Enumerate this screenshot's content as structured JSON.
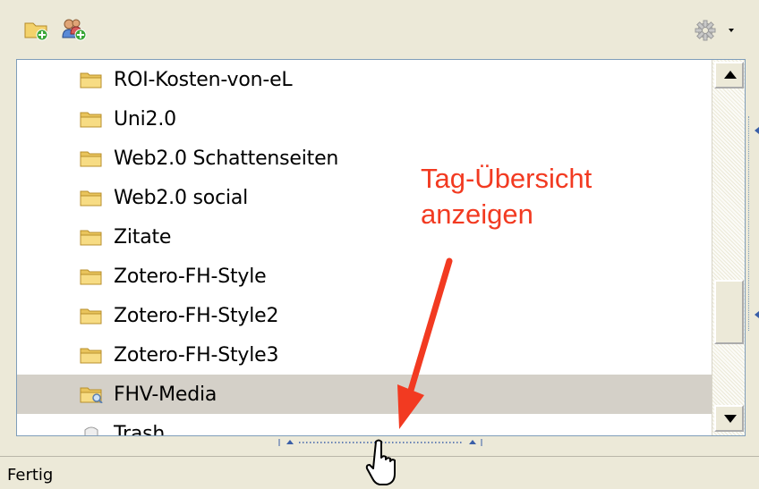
{
  "toolbar": {
    "new_collection_icon": "folder-add-icon",
    "new_group_icon": "users-add-icon",
    "actions_icon": "gear-icon"
  },
  "collections": [
    {
      "label": "ROI-Kosten-von-eL",
      "icon": "folder-icon",
      "selected": false
    },
    {
      "label": "Uni2.0",
      "icon": "folder-icon",
      "selected": false
    },
    {
      "label": "Web2.0 Schattenseiten",
      "icon": "folder-icon",
      "selected": false
    },
    {
      "label": "Web2.0 social",
      "icon": "folder-icon",
      "selected": false
    },
    {
      "label": "Zitate",
      "icon": "folder-icon",
      "selected": false
    },
    {
      "label": "Zotero-FH-Style",
      "icon": "folder-icon",
      "selected": false
    },
    {
      "label": "Zotero-FH-Style2",
      "icon": "folder-icon",
      "selected": false
    },
    {
      "label": "Zotero-FH-Style3",
      "icon": "folder-icon",
      "selected": false
    },
    {
      "label": "FHV-Media",
      "icon": "saved-search-folder-icon",
      "selected": true
    },
    {
      "label": "Trash",
      "icon": "trash-icon",
      "selected": false
    }
  ],
  "annotation": {
    "line1": "Tag-Übersicht",
    "line2": "anzeigen",
    "color": "#F23A21"
  },
  "status": {
    "text": "Fertig"
  }
}
